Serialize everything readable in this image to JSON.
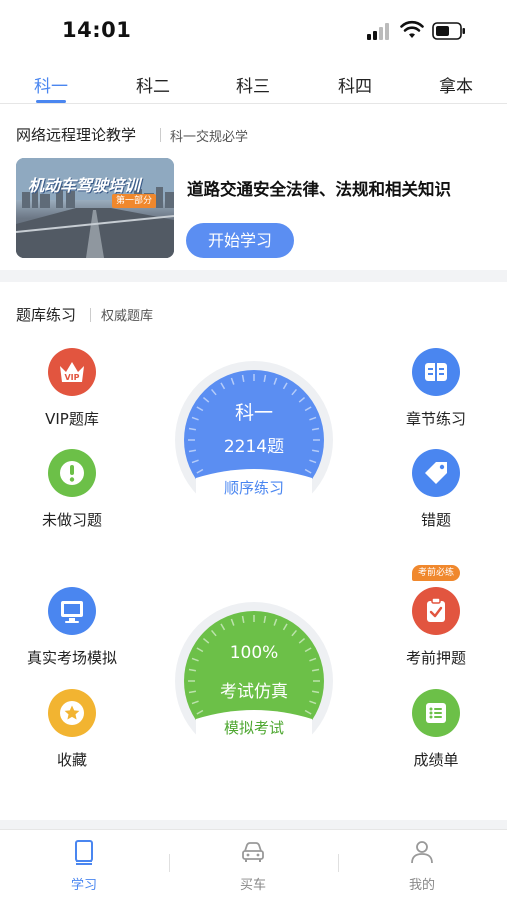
{
  "status_bar": {
    "time": "14:01"
  },
  "tabs": [
    {
      "label": "科一",
      "active": true
    },
    {
      "label": "科二",
      "active": false
    },
    {
      "label": "科三",
      "active": false
    },
    {
      "label": "科四",
      "active": false
    },
    {
      "label": "拿本",
      "active": false
    }
  ],
  "remote": {
    "title": "网络远程理论教学",
    "subtitle": "科一交规必学",
    "banner_title": "机动车驾驶培训",
    "banner_tag": "第一部分",
    "course_title": "道路交通安全法律、法规和相关知识",
    "start_label": "开始学习"
  },
  "bank": {
    "title": "题库练习",
    "subtitle": "权威题库",
    "items": {
      "vip": {
        "label": "VIP题库",
        "icon": "vip-icon",
        "icon_text": "VIP",
        "color": "#e2553f"
      },
      "chapter": {
        "label": "章节练习",
        "icon": "book-icon",
        "color": "#4a86f0"
      },
      "undone": {
        "label": "未做习题",
        "icon": "exclamation-icon",
        "color": "#6cc048"
      },
      "wrong": {
        "label": "错题",
        "icon": "tag-icon",
        "color": "#4a86f0"
      },
      "real_exam": {
        "label": "真实考场模拟",
        "icon": "monitor-icon",
        "color": "#4a86f0"
      },
      "predict": {
        "label": "考前押题",
        "icon": "clipboard-icon",
        "color": "#e2553f",
        "badge": "考前必练"
      },
      "favorite": {
        "label": "收藏",
        "icon": "star-icon",
        "color": "#f2b431"
      },
      "scores": {
        "label": "成绩单",
        "icon": "list-icon",
        "color": "#6cc048"
      }
    },
    "gauge_sequence": {
      "line1": "科一",
      "line2": "2214题",
      "action": "顺序练习",
      "color": "#5b8ef2"
    },
    "gauge_exam": {
      "line1": "100%",
      "line2": "考试仿真",
      "action": "模拟考试",
      "color": "#6cc048"
    }
  },
  "bottom_nav": [
    {
      "label": "学习",
      "icon": "study-book-icon",
      "active": true
    },
    {
      "label": "买车",
      "icon": "car-icon",
      "active": false
    },
    {
      "label": "我的",
      "icon": "person-icon",
      "active": false
    }
  ]
}
